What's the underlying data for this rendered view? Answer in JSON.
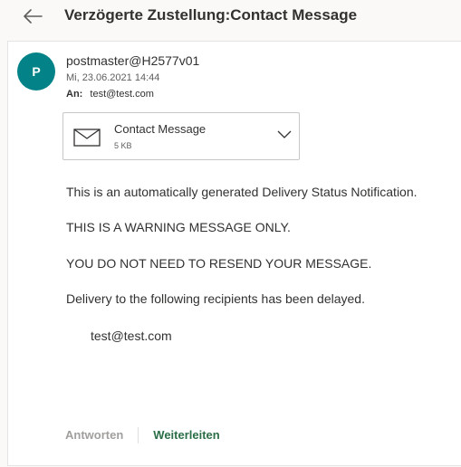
{
  "header": {
    "subject": "Verzögerte Zustellung:Contact Message"
  },
  "message": {
    "avatar_letter": "P",
    "sender": "postmaster@H2577v01",
    "date": "Mi, 23.06.2021 14:44",
    "to_label": "An:",
    "to_value": "test@test.com"
  },
  "attachment": {
    "name": "Contact Message",
    "size": "5 KB"
  },
  "body": {
    "line1": "This is an automatically generated Delivery Status Notification.",
    "line2": "THIS IS A WARNING MESSAGE ONLY.",
    "line3": "YOU DO NOT NEED TO RESEND YOUR MESSAGE.",
    "line4": "Delivery to the following recipients has been delayed.",
    "recipient": "test@test.com"
  },
  "actions": {
    "reply_label": "Antworten",
    "forward_label": "Weiterleiten"
  },
  "colors": {
    "avatar_bg": "#038387",
    "forward_text": "#2b6e47",
    "reply_text_disabled": "#a19f9d"
  },
  "icons": {
    "back": "arrow-left-icon",
    "attachment": "envelope-icon",
    "expand": "chevron-down-icon"
  }
}
